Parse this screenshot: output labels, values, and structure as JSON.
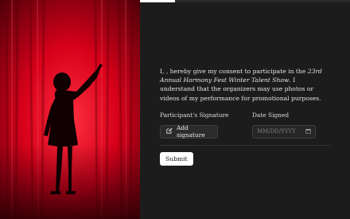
{
  "progress": {
    "fraction": 0.5
  },
  "consent": {
    "before": "I, , hereby give my consent to participate in the ",
    "event": "23rd Annual Harmony Fest Winter Talent Show",
    "after": ". I understand that the organizers may use photos or videos of my performance for promotional purposes."
  },
  "signature": {
    "label": "Participant's Signature",
    "button_label": "Add signature",
    "icon": "edit-icon"
  },
  "date": {
    "label": "Date Signed",
    "placeholder": "MM/DD/YYYY",
    "icon": "calendar-icon"
  },
  "submit_label": "Submit",
  "colors": {
    "curtain": "#d9001b",
    "background": "#1c1c1c",
    "accent": "#ffffff"
  }
}
